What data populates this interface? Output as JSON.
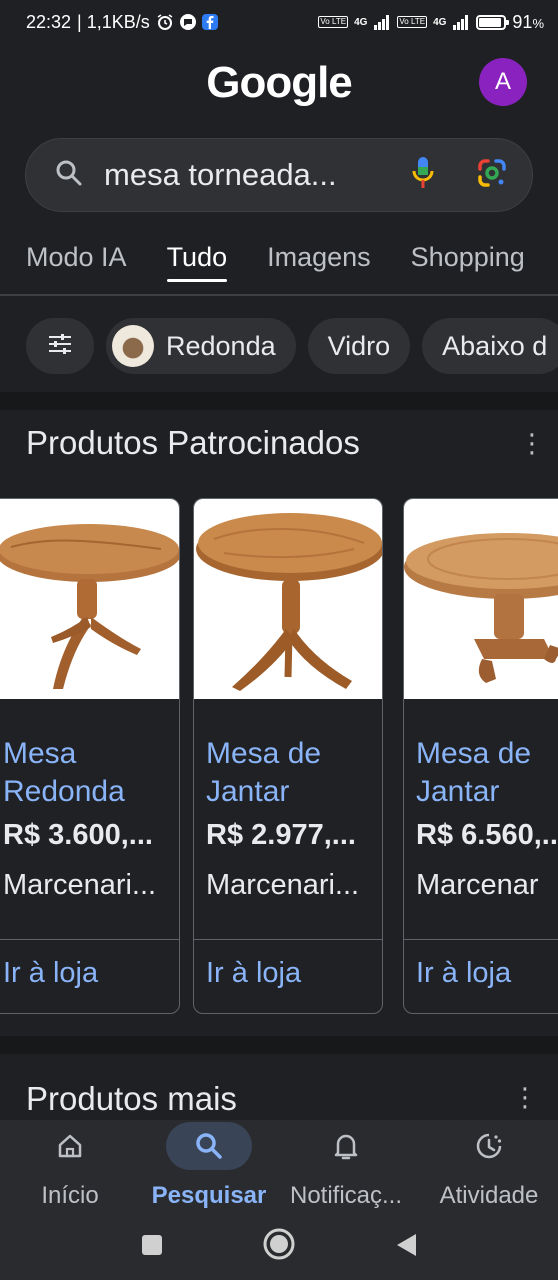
{
  "status_bar": {
    "time": "22:32",
    "speed": "| 1,1KB/s",
    "network_1": "4G",
    "network_2": "4G",
    "volte": "Vo LTE",
    "battery_percent": "91",
    "battery_unit": "%",
    "battery_level": 0.91
  },
  "header": {
    "logo": "Google",
    "avatar_letter": "A",
    "avatar_color": "#8a22bf"
  },
  "search": {
    "query": "mesa torneada..."
  },
  "tabs": [
    {
      "label": "Modo IA",
      "active": false
    },
    {
      "label": "Tudo",
      "active": true
    },
    {
      "label": "Imagens",
      "active": false
    },
    {
      "label": "Shopping",
      "active": false
    }
  ],
  "chips": [
    {
      "label": "Redonda"
    },
    {
      "label": "Vidro"
    },
    {
      "label": "Abaixo d"
    }
  ],
  "sponsored": {
    "title": "Produtos Patrocinados",
    "products": [
      {
        "title": "Mesa Redonda",
        "price": "R$ 3.600,...",
        "seller": "Marcenari...",
        "cta": "Ir à loja"
      },
      {
        "title": "Mesa de Jantar",
        "price": "R$ 2.977,...",
        "seller": "Marcenari...",
        "cta": "Ir à loja"
      },
      {
        "title": "Mesa de Jantar",
        "price": "R$ 6.560,...",
        "seller": "Marcenar",
        "cta": "Ir à loja"
      }
    ]
  },
  "section2": {
    "title": "Produtos mais"
  },
  "bottom_nav": [
    {
      "label": "Início",
      "icon": "home-icon",
      "active": false
    },
    {
      "label": "Pesquisar",
      "icon": "search-icon",
      "active": true
    },
    {
      "label": "Notificaç...",
      "icon": "bell-icon",
      "active": false
    },
    {
      "label": "Atividade",
      "icon": "activity-icon",
      "active": false
    }
  ],
  "colors": {
    "background": "#1f2023",
    "link": "#8ab4f8",
    "active_pill": "#394457"
  }
}
